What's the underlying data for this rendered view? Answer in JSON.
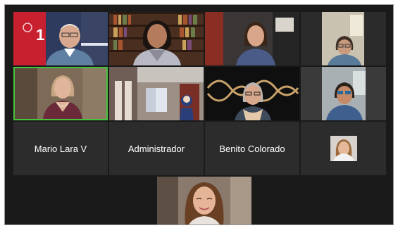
{
  "participants": [
    {
      "id": "p1",
      "kind": "video",
      "name": ""
    },
    {
      "id": "p2",
      "kind": "video",
      "name": ""
    },
    {
      "id": "p3",
      "kind": "video",
      "name": ""
    },
    {
      "id": "p4",
      "kind": "video",
      "name": ""
    },
    {
      "id": "p5",
      "kind": "video",
      "name": "",
      "active_speaker": true
    },
    {
      "id": "p6",
      "kind": "video",
      "name": ""
    },
    {
      "id": "p7",
      "kind": "video",
      "name": ""
    },
    {
      "id": "p8",
      "kind": "video",
      "name": ""
    },
    {
      "id": "p9",
      "kind": "name",
      "name": "Mario Lara V"
    },
    {
      "id": "p10",
      "kind": "name",
      "name": "Administrador"
    },
    {
      "id": "p11",
      "kind": "name",
      "name": "Benito Colorado"
    },
    {
      "id": "p12",
      "kind": "avatar",
      "name": ""
    },
    {
      "id": "p13",
      "kind": "video",
      "name": ""
    }
  ],
  "colors": {
    "background": "#1a1a1a",
    "tile": "#2c2c2c",
    "active_speaker_border": "#46c53c",
    "name_text": "#ffffff"
  }
}
